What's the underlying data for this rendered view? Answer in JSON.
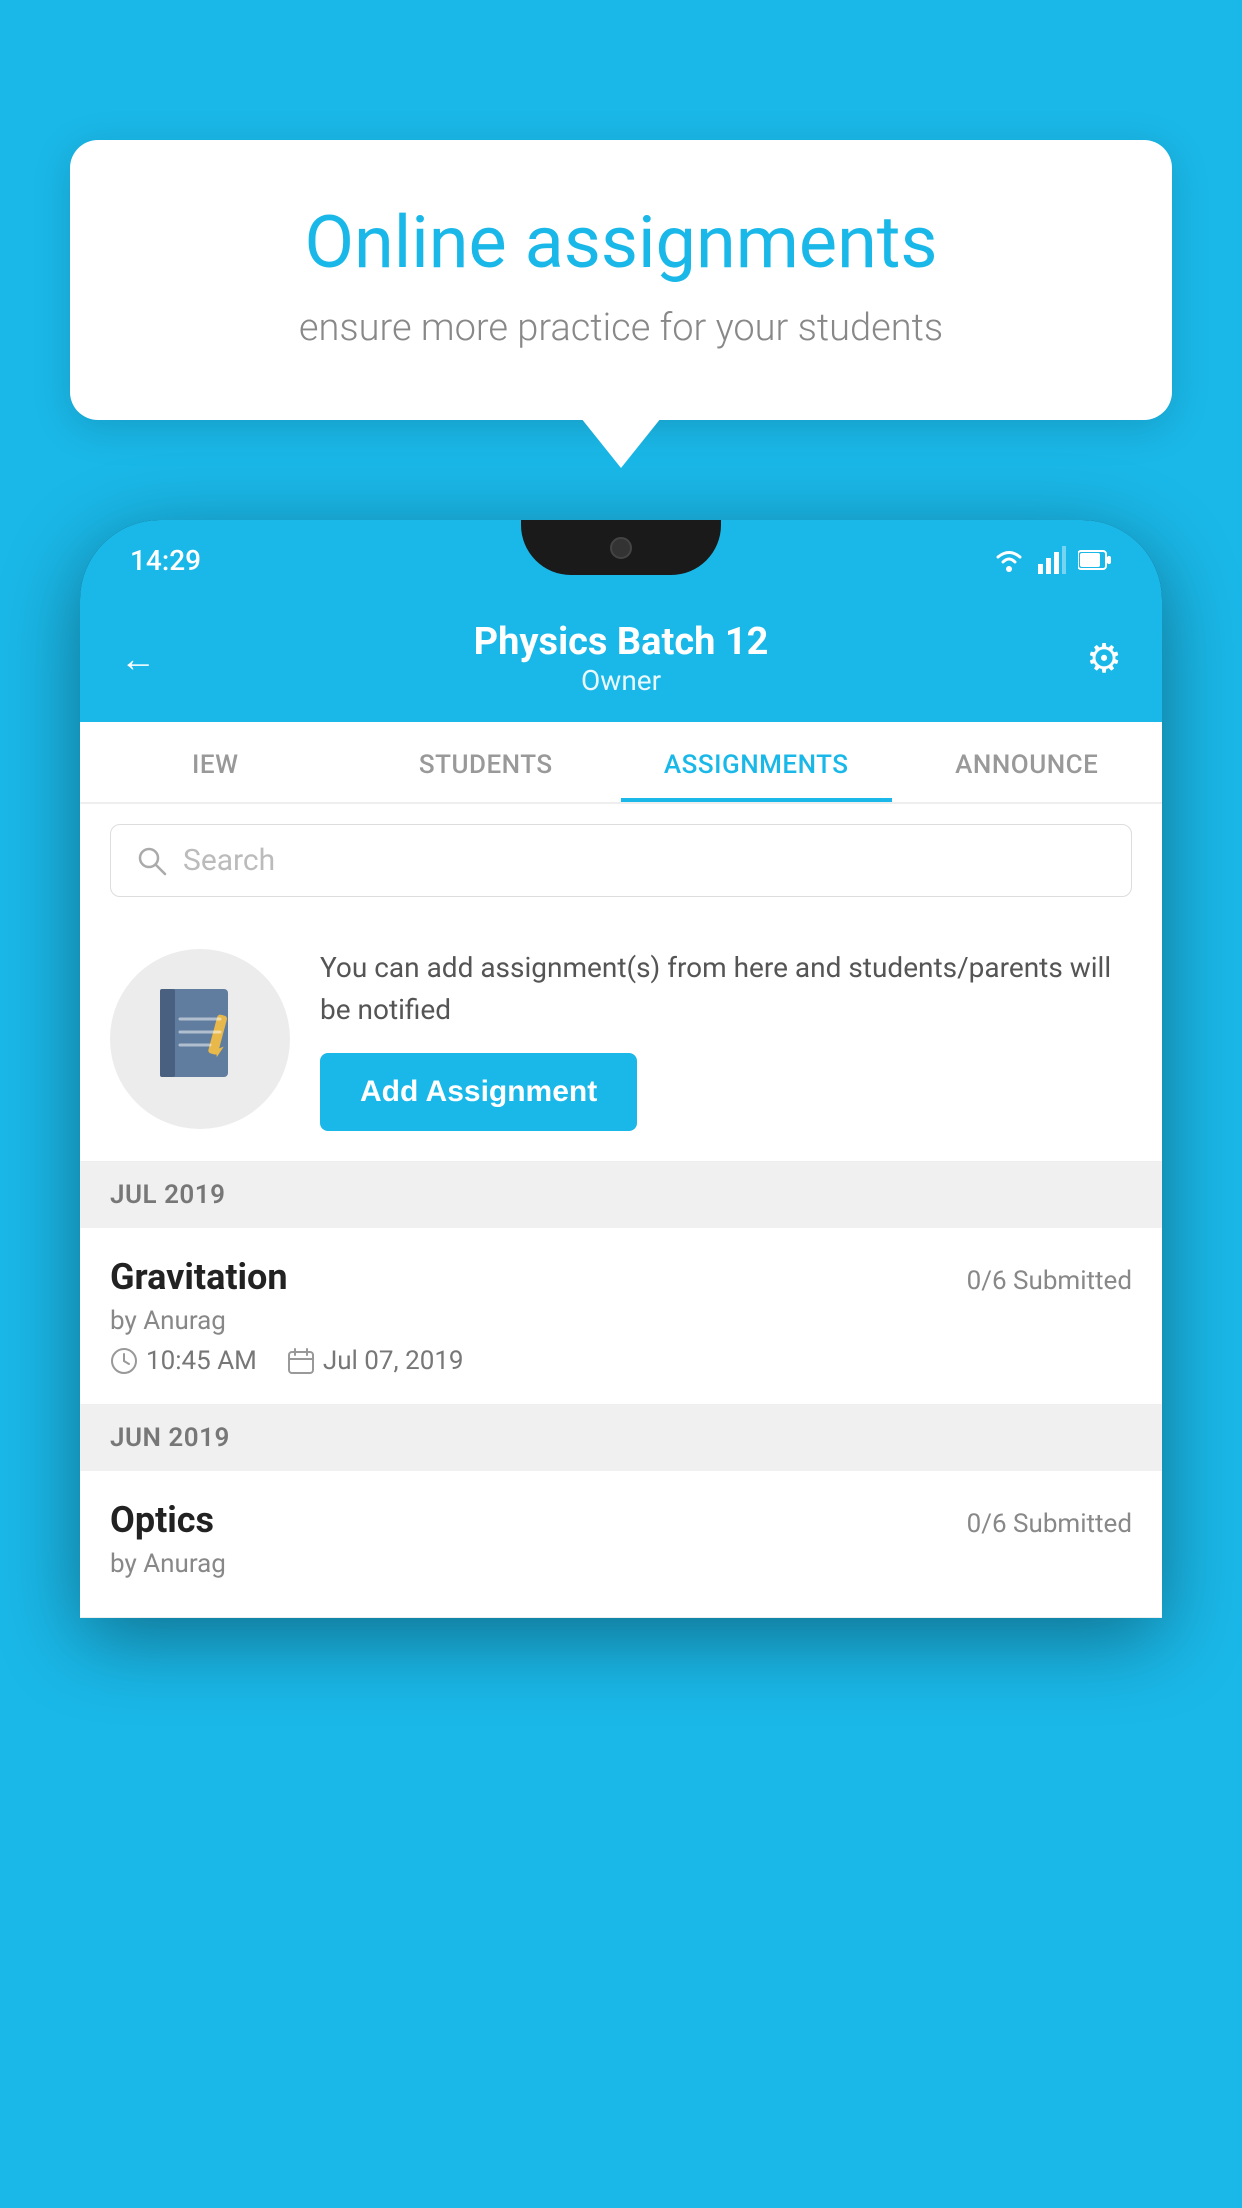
{
  "background_color": "#1ab8e8",
  "speech_bubble": {
    "title": "Online assignments",
    "subtitle": "ensure more practice for your students"
  },
  "phone": {
    "status_bar": {
      "time": "14:29",
      "icons": [
        "wifi",
        "signal",
        "battery"
      ]
    },
    "header": {
      "title": "Physics Batch 12",
      "subtitle": "Owner",
      "back_label": "←",
      "gear_label": "⚙"
    },
    "tabs": [
      {
        "label": "IEW",
        "active": false
      },
      {
        "label": "STUDENTS",
        "active": false
      },
      {
        "label": "ASSIGNMENTS",
        "active": true
      },
      {
        "label": "ANNOUNCE",
        "active": false
      }
    ],
    "search": {
      "placeholder": "Search"
    },
    "empty_state": {
      "description": "You can add assignment(s) from here and students/parents will be notified",
      "add_button_label": "Add Assignment"
    },
    "sections": [
      {
        "label": "JUL 2019",
        "assignments": [
          {
            "name": "Gravitation",
            "submitted": "0/6 Submitted",
            "by": "by Anurag",
            "time": "10:45 AM",
            "date": "Jul 07, 2019"
          }
        ]
      },
      {
        "label": "JUN 2019",
        "assignments": [
          {
            "name": "Optics",
            "submitted": "0/6 Submitted",
            "by": "by Anurag",
            "time": "",
            "date": ""
          }
        ]
      }
    ]
  }
}
